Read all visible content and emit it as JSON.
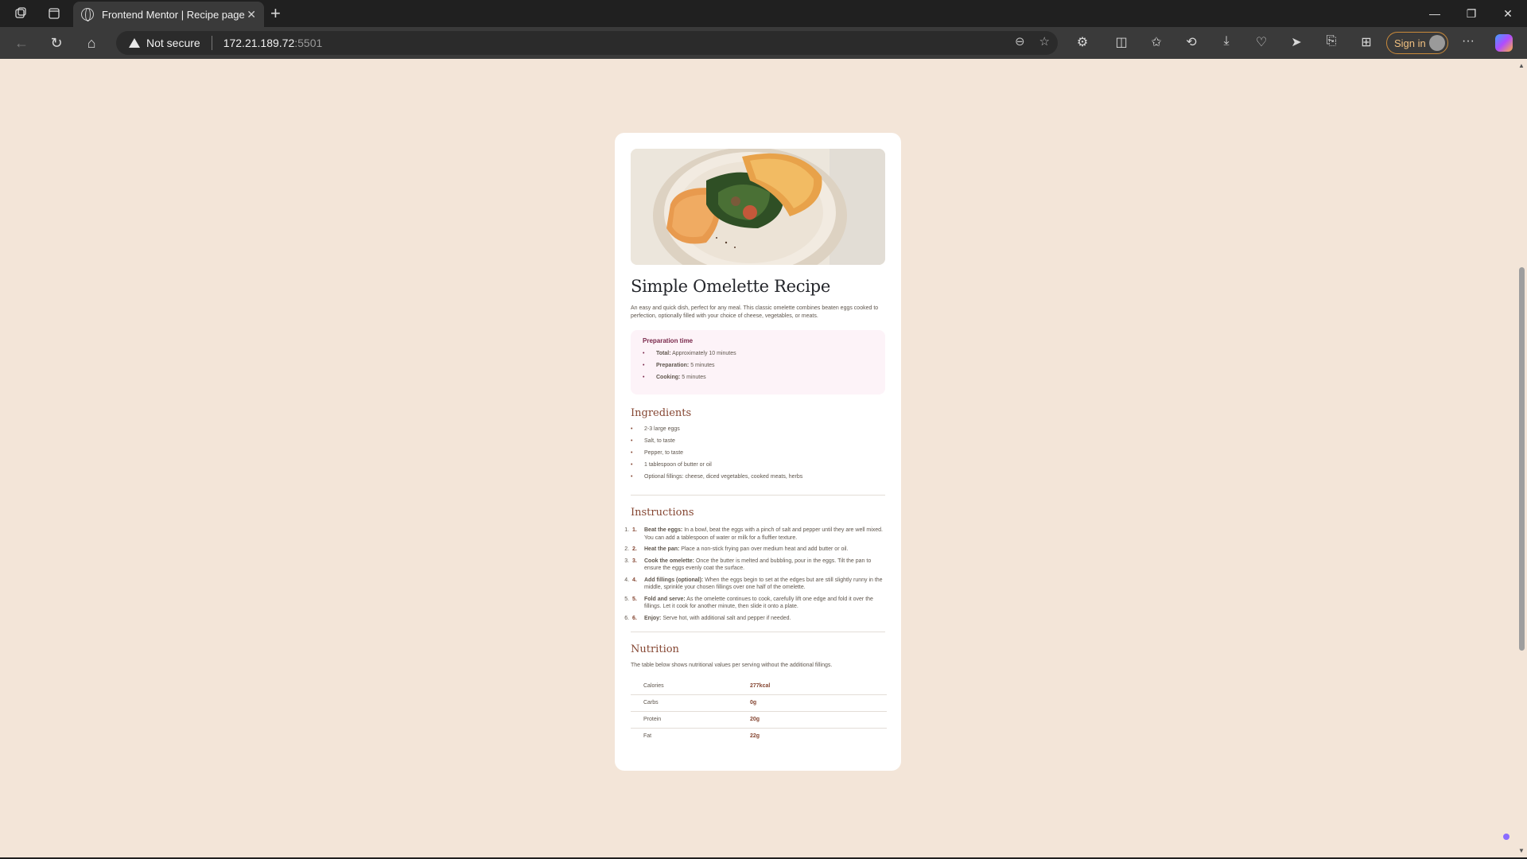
{
  "browser": {
    "tab_title": "Frontend Mentor | Recipe page",
    "security_label": "Not secure",
    "url_host": "172.21.189.72",
    "url_port": ":5501",
    "signin_label": "Sign in"
  },
  "recipe": {
    "title": "Simple Omelette Recipe",
    "intro": "An easy and quick dish, perfect for any meal. This classic omelette combines beaten eggs cooked to perfection, optionally filled with your choice of cheese, vegetables, or meats.",
    "prep": {
      "heading": "Preparation time",
      "items": [
        {
          "label": "Total:",
          "value": "Approximately 10 minutes"
        },
        {
          "label": "Preparation:",
          "value": "5 minutes"
        },
        {
          "label": "Cooking:",
          "value": "5 minutes"
        }
      ]
    },
    "ingredients": {
      "heading": "Ingredients",
      "items": [
        "2-3 large eggs",
        "Salt, to taste",
        "Pepper, to taste",
        "1 tablespoon of butter or oil",
        "Optional fillings: cheese, diced vegetables, cooked meats, herbs"
      ]
    },
    "instructions": {
      "heading": "Instructions",
      "steps": [
        {
          "num": "1.",
          "label": "Beat the eggs:",
          "text": "In a bowl, beat the eggs with a pinch of salt and pepper until they are well mixed. You can add a tablespoon of water or milk for a fluffier texture."
        },
        {
          "num": "2.",
          "label": "Heat the pan:",
          "text": "Place a non-stick frying pan over medium heat and add butter or oil."
        },
        {
          "num": "3.",
          "label": "Cook the omelette:",
          "text": "Once the butter is melted and bubbling, pour in the eggs. Tilt the pan to ensure the eggs evenly coat the surface."
        },
        {
          "num": "4.",
          "label": "Add fillings (optional):",
          "text": "When the eggs begin to set at the edges but are still slightly runny in the middle, sprinkle your chosen fillings over one half of the omelette."
        },
        {
          "num": "5.",
          "label": "Fold and serve:",
          "text": "As the omelette continues to cook, carefully lift one edge and fold it over the fillings. Let it cook for another minute, then slide it onto a plate."
        },
        {
          "num": "6.",
          "label": "Enjoy:",
          "text": "Serve hot, with additional salt and pepper if needed."
        }
      ]
    },
    "nutrition": {
      "heading": "Nutrition",
      "intro": "The table below shows nutritional values per serving without the additional fillings.",
      "rows": [
        {
          "name": "Calories",
          "value": "277kcal"
        },
        {
          "name": "Carbs",
          "value": "0g"
        },
        {
          "name": "Protein",
          "value": "20g"
        },
        {
          "name": "Fat",
          "value": "22g"
        }
      ]
    }
  },
  "colors": {
    "page_bg": "#f3e5d8",
    "card_bg": "#ffffff",
    "accent_brown": "#854632",
    "accent_rose": "#7a284b",
    "prep_bg": "#fdf3f8"
  }
}
